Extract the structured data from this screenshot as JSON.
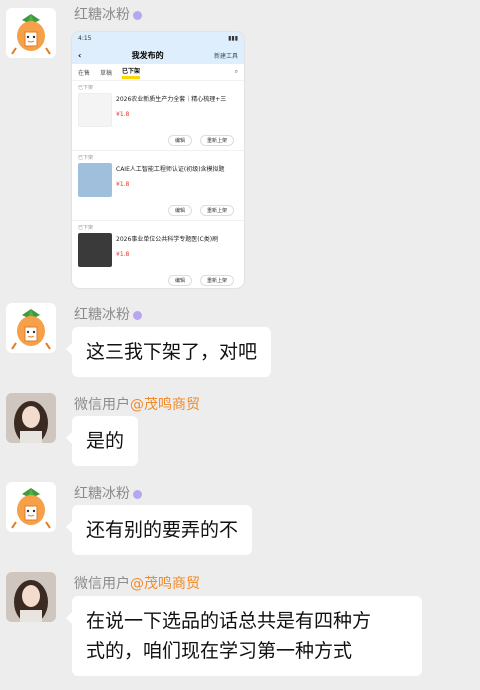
{
  "messages": [
    {
      "sender": "红糖冰粉",
      "screenshot": {
        "status_time": "4:15",
        "title": "我发布的",
        "header_right": "新建工具",
        "tabs": [
          "在售",
          "草稿",
          "已下架"
        ],
        "active_tab": "已下架",
        "items": [
          {
            "label": "已下架",
            "title": "2026农业新质生产力全套｜精心梳理+三",
            "sub": "",
            "price": "¥1.8",
            "btn1": "编辑",
            "btn2": "重新上架",
            "thumb_color": "#f4f4f4"
          },
          {
            "label": "已下架",
            "title": "CAIE人工智能工程师认证(初级)含模拟题",
            "sub": "",
            "price": "¥1.8",
            "btn1": "编辑",
            "btn2": "重新上架",
            "thumb_color": "#9fbfdc"
          },
          {
            "label": "已下架",
            "title": "2026事业单位公共科学专题医(C类)刷",
            "sub": "",
            "price": "¥1.8",
            "btn1": "编辑",
            "btn2": "重新上架",
            "thumb_color": "#3a3a3a"
          }
        ]
      }
    },
    {
      "sender": "红糖冰粉",
      "text": "这三我下架了，对吧"
    },
    {
      "sender": "微信用户",
      "sender_tag": "@茂鸣商贸",
      "text": "是的"
    },
    {
      "sender": "红糖冰粉",
      "text": "还有别的要弄的不"
    },
    {
      "sender": "微信用户",
      "sender_tag": "@茂鸣商贸",
      "text_line1": "在说一下选品的话总共是有四种方",
      "text_line2": "式的，咱们现在学习第一种方式"
    }
  ]
}
